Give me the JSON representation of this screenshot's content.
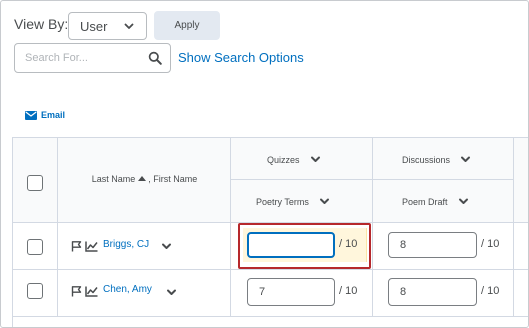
{
  "controls": {
    "view_by_label": "View By:",
    "view_by_value": "User",
    "apply_label": "Apply",
    "search_placeholder": "Search For...",
    "show_search_options": "Show Search Options",
    "email_label": "Email"
  },
  "table": {
    "name_header_last": "Last Name",
    "name_header_first": ", First Name",
    "categories": [
      {
        "title": "Quizzes",
        "item": "Poetry Terms"
      },
      {
        "title": "Discussions",
        "item": "Poem Draft"
      }
    ],
    "rows": [
      {
        "name": "Briggs, CJ",
        "grades": [
          "",
          "8"
        ],
        "out_of": [
          "/ 10",
          "/ 10"
        ]
      },
      {
        "name": "Chen, Amy",
        "grades": [
          "7",
          "8"
        ],
        "out_of": [
          "/ 10",
          "/ 10"
        ]
      }
    ]
  },
  "icons": {
    "select_chevron": "chevron-down-icon",
    "search": "search-icon",
    "email": "envelope-icon",
    "flag": "flag-icon",
    "graph": "line-graph-icon",
    "sort": "sort-ascending-icon"
  },
  "colors": {
    "link": "#006fbf",
    "highlight_border": "#b6282c",
    "highlight_fill": "#fff6dc",
    "focus_border": "#006fbf"
  }
}
